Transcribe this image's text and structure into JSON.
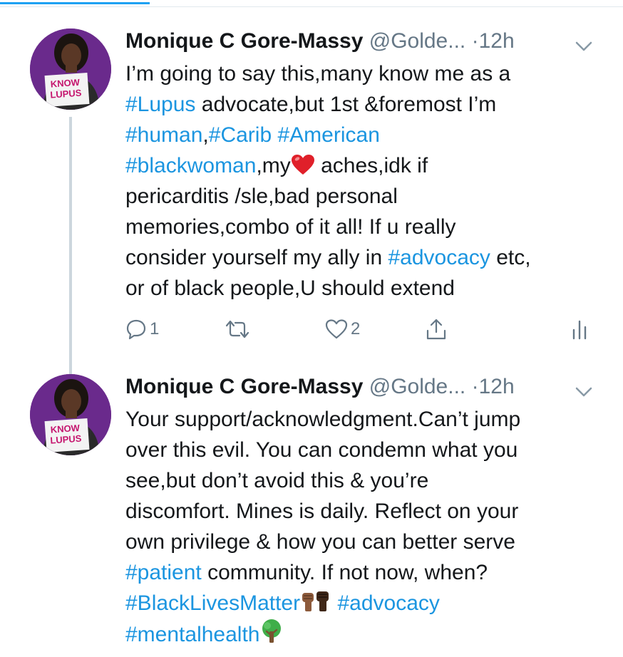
{
  "colors": {
    "accent": "#1da1f2",
    "link": "#1b95e0",
    "muted": "#657786",
    "avatar_bg": "#6a2a8c"
  },
  "avatar": {
    "sign_line1": "KNOW",
    "sign_line2": "LUPUS"
  },
  "tweets": [
    {
      "name": "Monique C Gore-Massy",
      "handle": "@Golde...",
      "separator": "·",
      "time": "12h",
      "lines": {
        "l1": "I’m going to say this,many know me as a",
        "l2_tag": "#Lupus",
        "l2_text": " advocate,but 1st &foremost I’m",
        "l3_tag1": "#human",
        "l3_text": ",",
        "l3_tag2": "#Carib",
        "l3_space": " ",
        "l3_tag3": "#American",
        "l4_tag": "#blackwoman",
        "l4_text1": ",my",
        "l4_emoji": "red-heart-emoji",
        "l4_text2": " aches,idk if",
        "l5": "pericarditis /sle,bad personal",
        "l6": "memories,combo of it all! If u really",
        "l7_text": "consider yourself my ally in ",
        "l7_tag": "#advocacy",
        "l7_end": " etc,",
        "l8": "or of black people,U should extend"
      },
      "actions": {
        "reply_count": "1",
        "like_count": "2"
      }
    },
    {
      "name": "Monique C Gore-Massy",
      "handle": "@Golde...",
      "separator": "·",
      "time": "12h",
      "lines": {
        "l1": "Your support/acknowledgment.Can’t jump",
        "l2": "over this evil. You can condemn what you",
        "l3": "see,but don’t avoid this & you’re",
        "l4": "discomfort. Mines is daily. Reflect on your",
        "l5": "own privilege & how you can better serve",
        "l6_tag": "#patient",
        "l6_text": " community. If not now, when?",
        "l7_tag1": "#BlackLivesMatter",
        "l7_emoji": "raised-fists-emoji",
        "l7_space": " ",
        "l7_tag2": "#advocacy",
        "l8_tag": "#mentalhealth",
        "l8_emoji": "tree-emoji"
      }
    }
  ]
}
